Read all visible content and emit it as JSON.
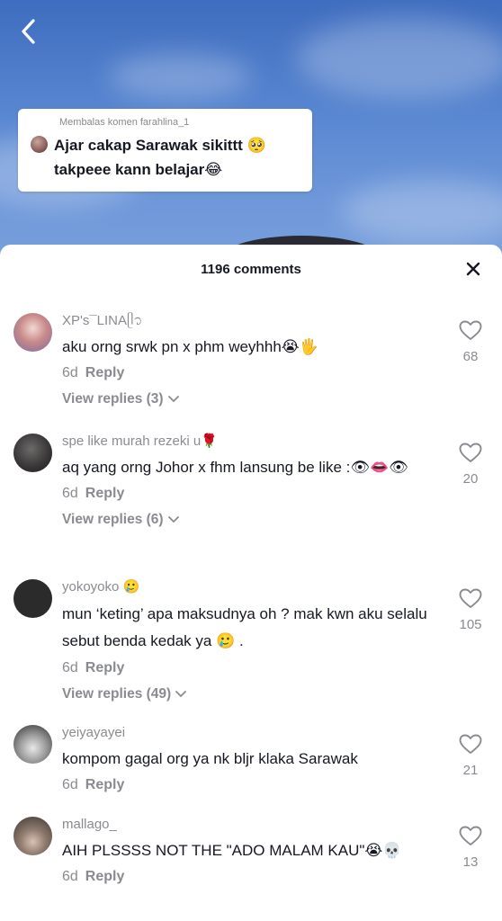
{
  "reply_card": {
    "label": "Membalas komen farahlina_1",
    "text_line1": "Ajar cakap Sarawak sikittt 🥺",
    "text_line2": "takpeee kann belajar😂"
  },
  "sheet": {
    "title": "1196 comments"
  },
  "comments": [
    {
      "username": "XP's¯LINAᥫ᭡",
      "text": "aku orng srwk pn x phm weyhhh😭🖐",
      "time": "6d",
      "reply_label": "Reply",
      "view_replies": "View replies (3)",
      "likes": "68"
    },
    {
      "username": "spe like murah rezeki u🌹",
      "text": "aq yang orng Johor x fhm lansung be like :👁👄👁",
      "time": "6d",
      "reply_label": "Reply",
      "view_replies": "View replies (6)",
      "likes": "20"
    },
    {
      "username": "yokoyoko 🥲",
      "text": "mun ‘keting’ apa maksudnya oh ? mak kwn aku selalu sebut benda kedak ya 🥲 .",
      "time": "6d",
      "reply_label": "Reply",
      "view_replies": "View replies (49)",
      "likes": "105"
    },
    {
      "username": "yeiyayayei",
      "text": "kompom gagal org ya nk bljr klaka Sarawak",
      "time": "6d",
      "reply_label": "Reply",
      "likes": "21"
    },
    {
      "username": "mallago_",
      "text": "AIH PLSSSS NOT THE \"ADO MALAM KAU\"😭💀",
      "time": "6d",
      "reply_label": "Reply",
      "likes": "13"
    }
  ],
  "icons": {
    "back": "chevron-left-icon",
    "close": "close-icon",
    "like": "heart-outline-icon",
    "expand": "chevron-down-icon"
  },
  "colors": {
    "primary_text": "#161823",
    "secondary_text": "#8a8b91",
    "sheet_bg": "#ffffff"
  }
}
